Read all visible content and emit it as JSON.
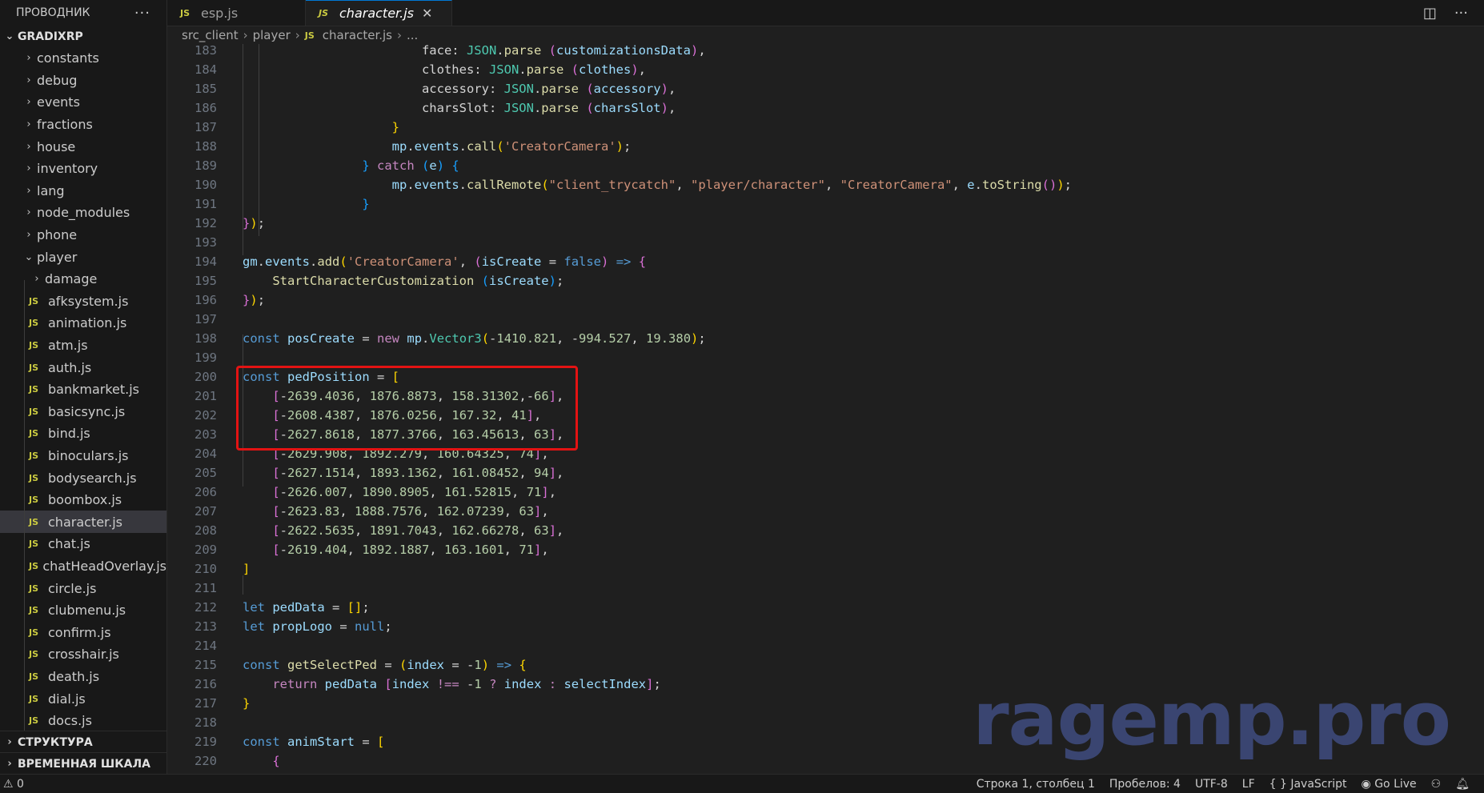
{
  "explorer": {
    "title": "ПРОВОДНИК",
    "more_icon": "ellipsis-icon",
    "project": "GRADIXRP",
    "folders": [
      "constants",
      "debug",
      "events",
      "fractions",
      "house",
      "inventory",
      "lang",
      "node_modules",
      "phone"
    ],
    "open_folder": "player",
    "subfolder": "damage",
    "files": [
      "afksystem.js",
      "animation.js",
      "atm.js",
      "auth.js",
      "bankmarket.js",
      "basicsync.js",
      "bind.js",
      "binoculars.js",
      "bodysearch.js",
      "boombox.js",
      "character.js",
      "chat.js",
      "chatHeadOverlay.js",
      "circle.js",
      "clubmenu.js",
      "confirm.js",
      "crosshair.js",
      "death.js",
      "dial.js",
      "docs.js"
    ],
    "active_file": "character.js",
    "outline": "СТРУКТУРА",
    "timeline": "ВРЕМЕННАЯ ШКАЛА"
  },
  "tabs": [
    {
      "label": "esp.js",
      "badge": "JS"
    },
    {
      "label": "character.js",
      "badge": "JS",
      "close": "✕"
    }
  ],
  "breadcrumb": [
    "src_client",
    "player",
    "character.js",
    "..."
  ],
  "code": {
    "lines": [
      {
        "n": "183",
        "html": "                        face: <span class='cls'>JSON</span>.<span class='fn'>parse</span> <span class='br2'>(</span><span class='var'>customizationsData</span><span class='br2'>)</span>,"
      },
      {
        "n": "184",
        "html": "                        clothes: <span class='cls'>JSON</span>.<span class='fn'>parse</span> <span class='br2'>(</span><span class='var'>clothes</span><span class='br2'>)</span>,"
      },
      {
        "n": "185",
        "html": "                        accessory: <span class='cls'>JSON</span>.<span class='fn'>parse</span> <span class='br2'>(</span><span class='var'>accessory</span><span class='br2'>)</span>,"
      },
      {
        "n": "186",
        "html": "                        charsSlot: <span class='cls'>JSON</span>.<span class='fn'>parse</span> <span class='br2'>(</span><span class='var'>charsSlot</span><span class='br2'>)</span>,"
      },
      {
        "n": "187",
        "html": "                    <span class='br1'>}</span>"
      },
      {
        "n": "188",
        "html": "                    <span class='var'>mp</span>.<span class='var'>events</span>.<span class='fn'>call</span><span class='br1'>(</span><span class='str'>'CreatorCamera'</span><span class='br1'>)</span>;"
      },
      {
        "n": "189",
        "html": "                <span class='br3'>}</span> <span class='kw2'>catch</span> <span class='br3'>(</span><span class='var'>e</span><span class='br3'>)</span> <span class='br3'>{</span>"
      },
      {
        "n": "190",
        "html": "                    <span class='var'>mp</span>.<span class='var'>events</span>.<span class='fn'>callRemote</span><span class='br1'>(</span><span class='str'>\"client_trycatch\"</span>, <span class='str'>\"player/character\"</span>, <span class='str'>\"CreatorCamera\"</span>, <span class='var'>e</span>.<span class='fn'>toString</span><span class='br2'>()</span><span class='br1'>)</span>;"
      },
      {
        "n": "191",
        "html": "                <span class='br3'>}</span>"
      },
      {
        "n": "192",
        "html": "<span class='br2'>}</span><span class='br1'>)</span>;"
      },
      {
        "n": "193",
        "html": ""
      },
      {
        "n": "194",
        "html": "<span class='var'>gm</span>.<span class='var'>events</span>.<span class='fn'>add</span><span class='br1'>(</span><span class='str'>'CreatorCamera'</span>, <span class='br2'>(</span><span class='var'>isCreate</span> = <span class='kw'>false</span><span class='br2'>)</span> <span class='kw'>=&gt;</span> <span class='br2'>{</span>"
      },
      {
        "n": "195",
        "html": "    <span class='fn'>StartCharacterCustomization</span> <span class='br3'>(</span><span class='var'>isCreate</span><span class='br3'>)</span>;"
      },
      {
        "n": "196",
        "html": "<span class='br2'>}</span><span class='br1'>)</span>;"
      },
      {
        "n": "197",
        "html": ""
      },
      {
        "n": "198",
        "html": "<span class='kw'>const</span> <span class='var'>posCreate</span> = <span class='kw2'>new</span> <span class='var'>mp</span>.<span class='cls'>Vector3</span><span class='br1'>(</span>-<span class='num'>1410.821</span>, -<span class='num'>994.527</span>, <span class='num'>19.380</span><span class='br1'>)</span>;"
      },
      {
        "n": "199",
        "html": ""
      },
      {
        "n": "200",
        "html": "<span class='kw'>const</span> <span class='var'>pedPosition</span> = <span class='br1'>[</span>"
      },
      {
        "n": "201",
        "html": "    <span class='br2'>[</span>-<span class='num'>2639.4036</span>, <span class='num'>1876.8873</span>, <span class='num'>158.31302</span>,-<span class='num'>66</span><span class='br2'>]</span>,"
      },
      {
        "n": "202",
        "html": "    <span class='br2'>[</span>-<span class='num'>2608.4387</span>, <span class='num'>1876.0256</span>, <span class='num'>167.32</span>, <span class='num'>41</span><span class='br2'>]</span>,"
      },
      {
        "n": "203",
        "html": "    <span class='br2'>[</span>-<span class='num'>2627.8618</span>, <span class='num'>1877.3766</span>, <span class='num'>163.45613</span>, <span class='num'>63</span><span class='br2'>]</span>,"
      },
      {
        "n": "204",
        "html": "    <span class='br2'>[</span>-<span class='num'>2629.908</span>, <span class='num'>1892.279</span>, <span class='num'>160.64325</span>, <span class='num'>74</span><span class='br2'>]</span>,"
      },
      {
        "n": "205",
        "html": "    <span class='br2'>[</span>-<span class='num'>2627.1514</span>, <span class='num'>1893.1362</span>, <span class='num'>161.08452</span>, <span class='num'>94</span><span class='br2'>]</span>,"
      },
      {
        "n": "206",
        "html": "    <span class='br2'>[</span>-<span class='num'>2626.007</span>, <span class='num'>1890.8905</span>, <span class='num'>161.52815</span>, <span class='num'>71</span><span class='br2'>]</span>,"
      },
      {
        "n": "207",
        "html": "    <span class='br2'>[</span>-<span class='num'>2623.83</span>, <span class='num'>1888.7576</span>, <span class='num'>162.07239</span>, <span class='num'>63</span><span class='br2'>]</span>,"
      },
      {
        "n": "208",
        "html": "    <span class='br2'>[</span>-<span class='num'>2622.5635</span>, <span class='num'>1891.7043</span>, <span class='num'>162.66278</span>, <span class='num'>63</span><span class='br2'>]</span>,"
      },
      {
        "n": "209",
        "html": "    <span class='br2'>[</span>-<span class='num'>2619.404</span>, <span class='num'>1892.1887</span>, <span class='num'>163.1601</span>, <span class='num'>71</span><span class='br2'>]</span>,"
      },
      {
        "n": "210",
        "html": "<span class='br1'>]</span>"
      },
      {
        "n": "211",
        "html": ""
      },
      {
        "n": "212",
        "html": "<span class='kw'>let</span> <span class='var'>pedData</span> = <span class='br1'>[]</span>;"
      },
      {
        "n": "213",
        "html": "<span class='kw'>let</span> <span class='var'>propLogo</span> = <span class='kw'>null</span>;"
      },
      {
        "n": "214",
        "html": ""
      },
      {
        "n": "215",
        "html": "<span class='kw'>const</span> <span class='fn'>getSelectPed</span> = <span class='br1'>(</span><span class='var'>index</span> = -<span class='num'>1</span><span class='br1'>)</span> <span class='kw'>=&gt;</span> <span class='br1'>{</span>"
      },
      {
        "n": "216",
        "html": "    <span class='kw2'>return</span> <span class='var'>pedData</span> <span class='br2'>[</span><span class='var'>index</span> <span class='kw2'>!==</span> -<span class='num'>1</span> <span class='kw2'>?</span> <span class='var'>index</span> <span class='kw2'>:</span> <span class='var'>selectIndex</span><span class='br2'>]</span>;"
      },
      {
        "n": "217",
        "html": "<span class='br1'>}</span>"
      },
      {
        "n": "218",
        "html": ""
      },
      {
        "n": "219",
        "html": "<span class='kw'>const</span> <span class='var'>animStart</span> = <span class='br1'>[</span>"
      },
      {
        "n": "220",
        "html": "    <span class='br2'>{</span>"
      }
    ]
  },
  "watermark": "ragemp.pro",
  "status": {
    "left": "⚠ 0",
    "position": "Строка 1, столбец 1",
    "spaces": "Пробелов: 4",
    "encoding": "UTF-8",
    "eol": "LF",
    "language": "{ } JavaScript",
    "golive": "Go Live"
  },
  "colors": {
    "accent": "#0078d4",
    "highlight": "#e31313",
    "watermark": "#3d4a7a"
  }
}
